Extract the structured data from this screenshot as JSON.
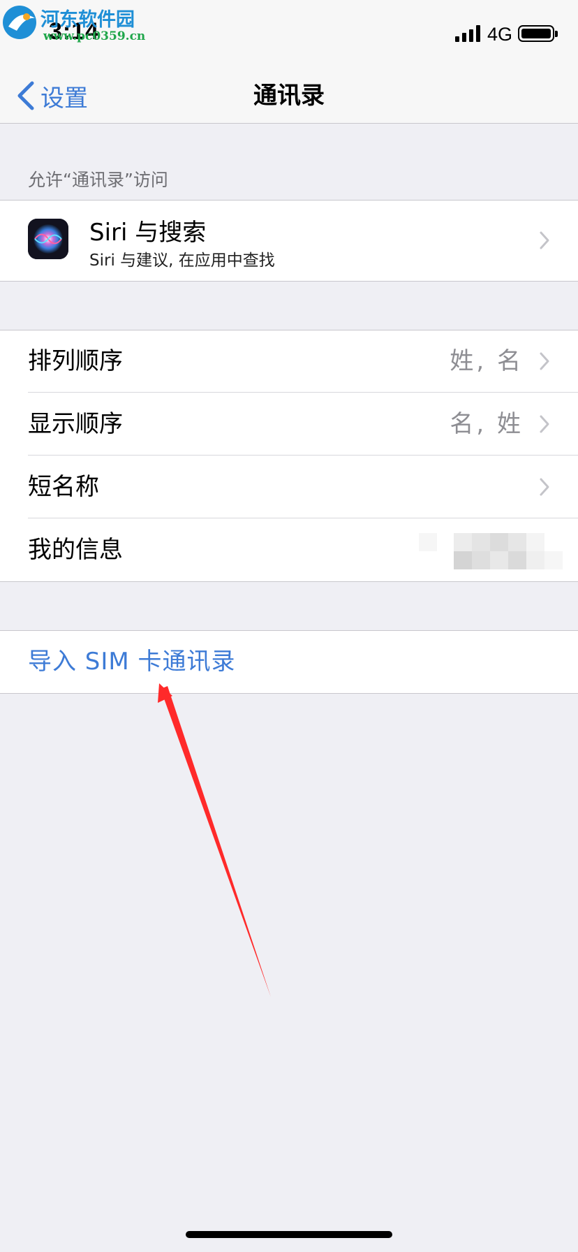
{
  "watermark": {
    "name": "河东软件园",
    "url": "www.pc0359.cn"
  },
  "status": {
    "time": "3:14",
    "network": "4G"
  },
  "nav": {
    "back_label": "设置",
    "title": "通讯录"
  },
  "section1": {
    "header": "允许“通讯录”访问",
    "siri": {
      "title": "Siri 与搜索",
      "subtitle": "Siri 与建议, 在应用中查找"
    }
  },
  "section2": {
    "rows": [
      {
        "label": "排列顺序",
        "value": "姓, 名"
      },
      {
        "label": "显示顺序",
        "value": "名, 姓"
      },
      {
        "label": "短名称",
        "value": ""
      },
      {
        "label": "我的信息",
        "value": ""
      }
    ]
  },
  "section3": {
    "import_label": "导入 SIM 卡通讯录"
  },
  "colors": {
    "accent": "#3d7bd6",
    "background": "#efeff4",
    "annotation_arrow": "#ff2a2a"
  }
}
